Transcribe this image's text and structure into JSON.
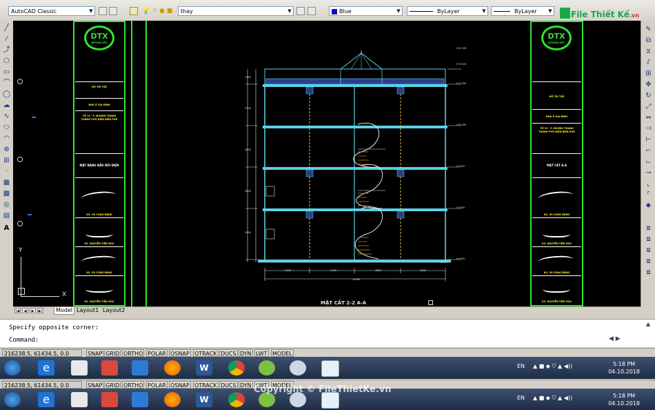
{
  "toolbar": {
    "workspace": "AutoCAD Classic",
    "layer": "thay",
    "color": "Blue",
    "linetype": "ByLayer",
    "lineweight": "ByLayer",
    "color_hex": "#0000ff"
  },
  "brand_watermark": {
    "logo_text": "File Thiết Kế",
    "logo_suffix": ".vn"
  },
  "title_block": {
    "logo": "DTX",
    "logo_sub": "DESIGN ART",
    "left": {
      "row1": "ĐỖ TRÍ TUỆ",
      "row2": "NHÀ Ở GIA ĐÌNH",
      "row3": "TỔ 13 - P. MƯỜNG THANH",
      "row3b": "THÀNH PHỐ ĐIỆN BIÊN PHỦ",
      "row4": "MẶT BẰNG ĐẦU NỐI ĐIỆN",
      "sig1": "KS. VŨ CÔNG ĐĂNG",
      "sig2": "KS. NGUYỄN TIẾN HỮU",
      "sig3": "KS. VŨ CÔNG ĐĂNG",
      "sig4": "KS. NGUYỄN TIẾN HỮU"
    },
    "right": {
      "row1": "ĐỖ TRÍ TUỆ",
      "row2": "NHÀ Ở GIA ĐÌNH",
      "row3": "TỔ 13 - P. MƯỜNG THANH",
      "row3b": "THÀNH PHỐ ĐIỆN BIÊN PHỦ",
      "row4": "MẶT CẮT A-A",
      "sig1": "KS. VŨ CÔNG ĐĂNG",
      "sig2": "KS. NGUYỄN TIẾN HỮU",
      "sig3": "KS. VŨ CÔNG ĐĂNG",
      "sig4": "KS. NGUYỄN TIẾN HỮU"
    }
  },
  "drawing": {
    "section_title": "MẶT CẮT 2-2 A-A",
    "levels": [
      "+15.300",
      "+13.500",
      "+12.000",
      "+10.500",
      "+7.500",
      "+3.900",
      "+0.000",
      "-0.750"
    ],
    "bottom_dims": [
      "4400",
      "4400",
      "3600",
      "2900"
    ],
    "total_dim": "15300",
    "left_dims": [
      "1200",
      "3300",
      "3600",
      "3600",
      "3900"
    ]
  },
  "layout_tabs": [
    "Model",
    "Layout1",
    "Layout2"
  ],
  "ucs": {
    "x_label": "X",
    "y_label": "Y"
  },
  "command": {
    "history": "Specify opposite corner:",
    "prompt": "Command:"
  },
  "status": {
    "coords": "216238.5, 61434.5, 0.0",
    "buttons": [
      "SNAP",
      "GRID",
      "ORTHO",
      "POLAR",
      "OSNAP",
      "OTRACK",
      "DUCS",
      "DYN",
      "LWT",
      "MODEL"
    ]
  },
  "taskbar": {
    "lang": "EN",
    "time": "5:18 PM",
    "date": "04.10.2018"
  },
  "copyright": "Copyright © FileThietKe.vn"
}
